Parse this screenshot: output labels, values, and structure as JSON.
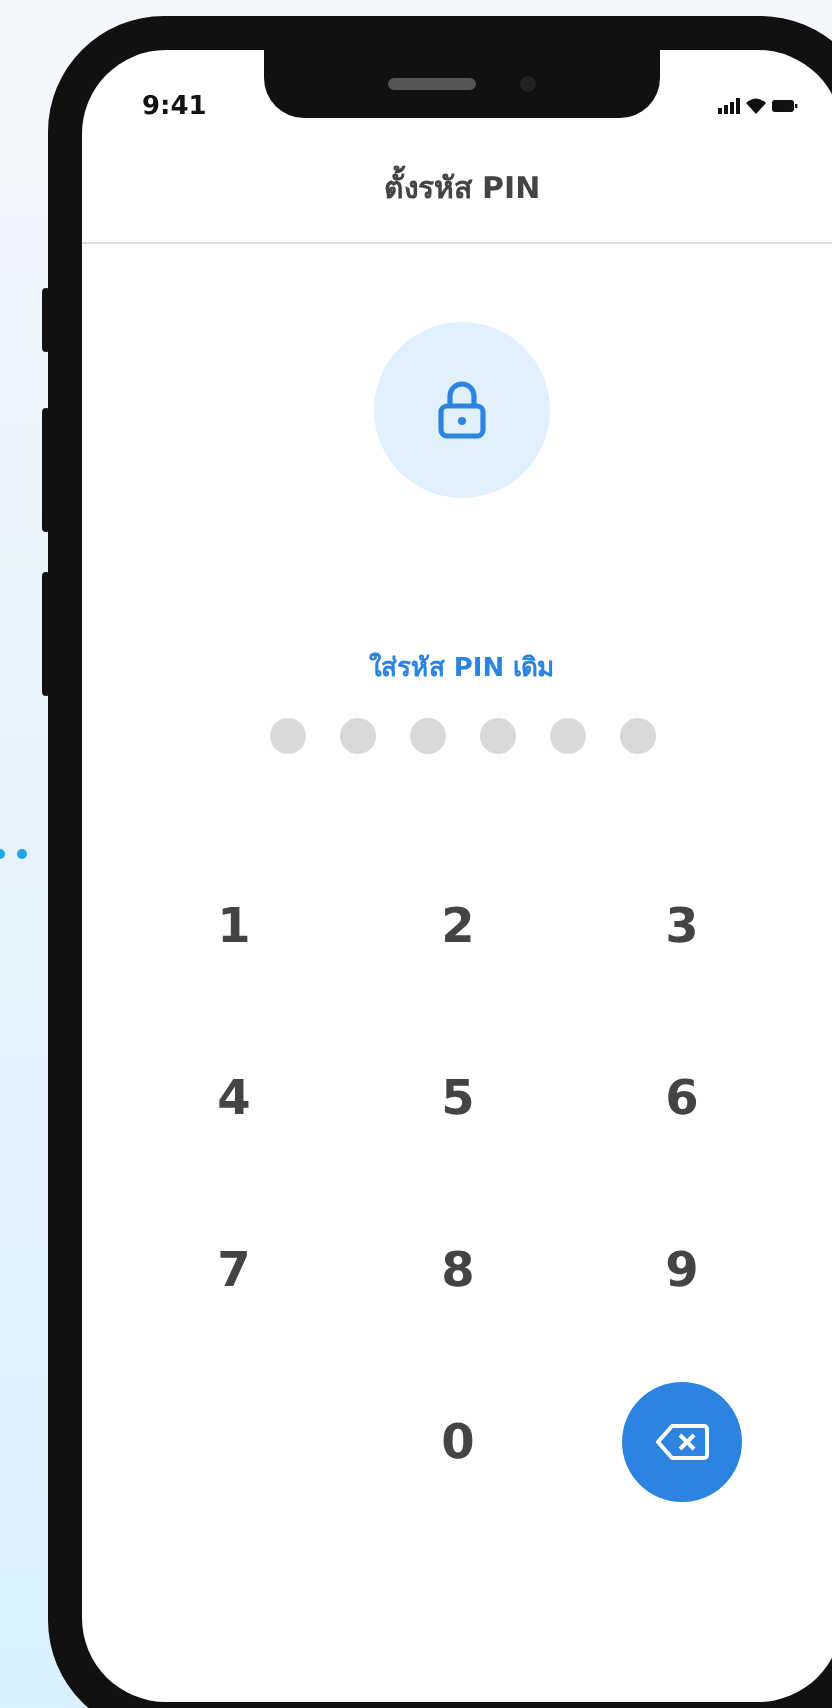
{
  "status_bar": {
    "time": "9:41"
  },
  "header": {
    "title": "ตั้งรหัส PIN"
  },
  "pin": {
    "prompt": "ใส่รหัส PIN เดิม",
    "dots": [
      {
        "filled": false
      },
      {
        "filled": false
      },
      {
        "filled": false
      },
      {
        "filled": false
      },
      {
        "filled": false
      },
      {
        "filled": false
      }
    ]
  },
  "keypad": [
    {
      "kind": "digit",
      "label": "1"
    },
    {
      "kind": "digit",
      "label": "2"
    },
    {
      "kind": "digit",
      "label": "3"
    },
    {
      "kind": "digit",
      "label": "4"
    },
    {
      "kind": "digit",
      "label": "5"
    },
    {
      "kind": "digit",
      "label": "6"
    },
    {
      "kind": "digit",
      "label": "7"
    },
    {
      "kind": "digit",
      "label": "8"
    },
    {
      "kind": "digit",
      "label": "9"
    },
    {
      "kind": "empty"
    },
    {
      "kind": "digit",
      "label": "0"
    },
    {
      "kind": "delete"
    }
  ]
}
